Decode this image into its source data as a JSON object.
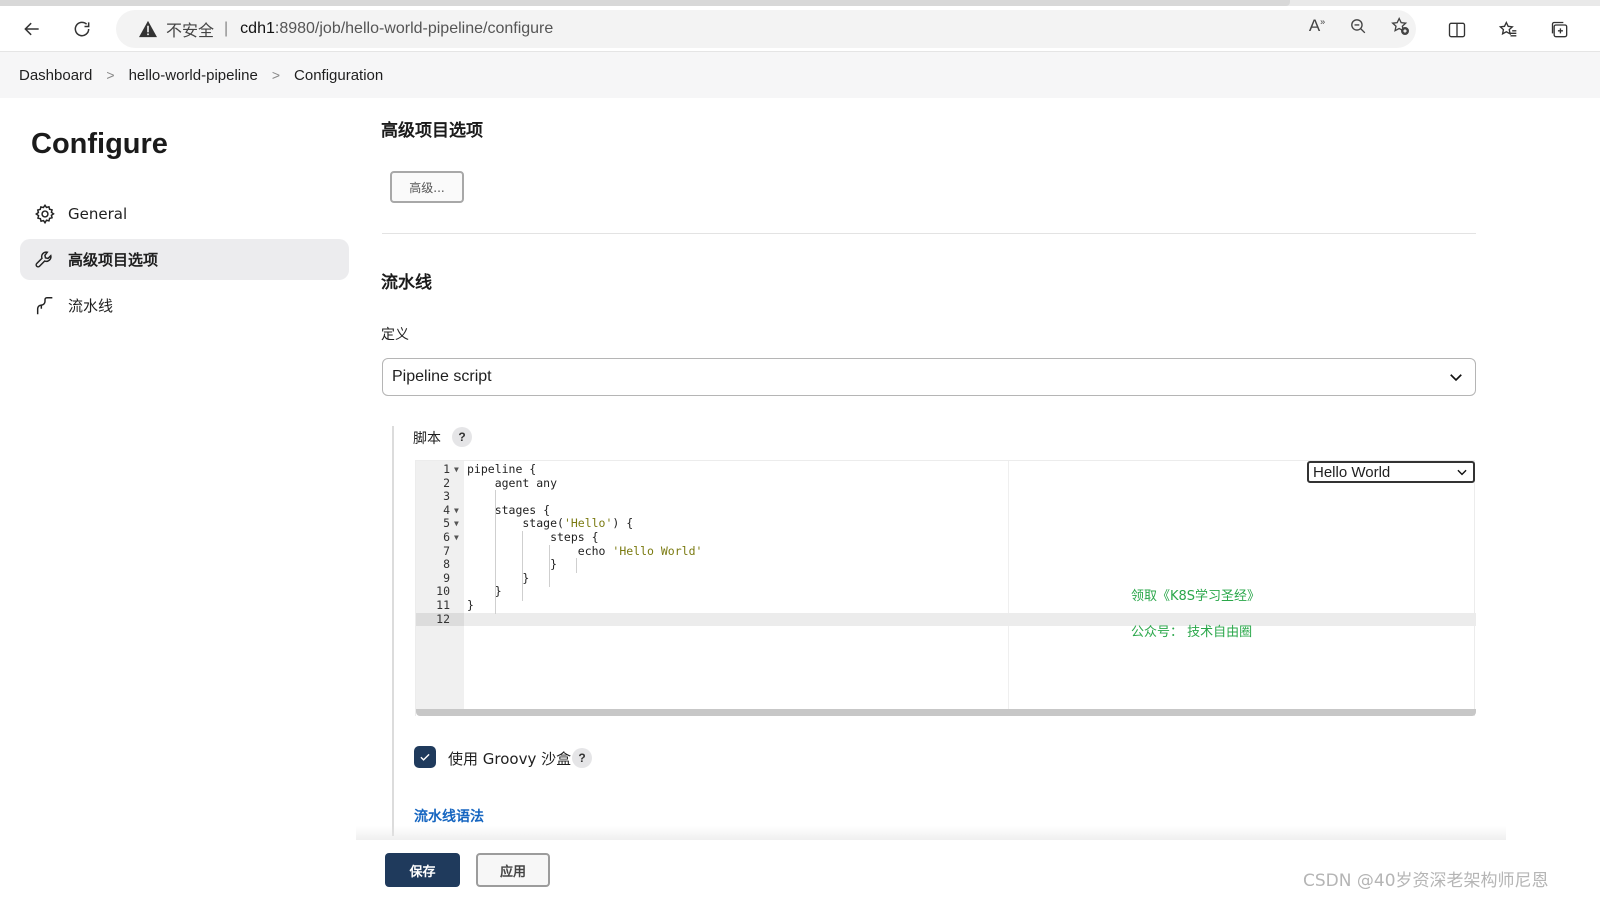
{
  "browser": {
    "security_label": "不安全",
    "separator": "|",
    "url_host": "cdh1",
    "url_path": ":8980/job/hello-world-pipeline/configure"
  },
  "breadcrumb": {
    "items": [
      "Dashboard",
      "hello-world-pipeline",
      "Configuration"
    ],
    "separator": ">"
  },
  "sidebar": {
    "title": "Configure",
    "items": [
      {
        "label": "General",
        "icon": "gear-icon"
      },
      {
        "label": "高级项目选项",
        "icon": "wrench-icon",
        "active": true
      },
      {
        "label": "流水线",
        "icon": "pipeline-icon"
      }
    ]
  },
  "advanced": {
    "title": "高级项目选项",
    "button_label": "高级..."
  },
  "pipeline": {
    "title": "流水线",
    "definition_label": "定义",
    "definition_value": "Pipeline script",
    "script_label": "脚本",
    "help": "?",
    "sample_value": "Hello World",
    "code": [
      {
        "n": "1",
        "text": "pipeline {",
        "fold": true
      },
      {
        "n": "2",
        "text": "    agent any"
      },
      {
        "n": "3",
        "text": ""
      },
      {
        "n": "4",
        "text": "    stages {",
        "fold": true
      },
      {
        "n": "5",
        "pre": "        stage(",
        "str": "'Hello'",
        "post": ") {",
        "fold": true
      },
      {
        "n": "6",
        "text": "            steps {",
        "fold": true
      },
      {
        "n": "7",
        "pre": "                echo ",
        "str": "'Hello World'",
        "post": ""
      },
      {
        "n": "8",
        "text": "            }"
      },
      {
        "n": "9",
        "text": "        }"
      },
      {
        "n": "10",
        "text": "    }"
      },
      {
        "n": "11",
        "text": "}"
      },
      {
        "n": "12",
        "text": "",
        "active": true
      }
    ],
    "promo_line1": "领取《K8S学习圣经》",
    "promo_line2": "公众号： 技术自由圈",
    "sandbox_label": "使用 Groovy 沙盒",
    "syntax_link": "流水线语法"
  },
  "footer": {
    "save_label": "保存",
    "apply_label": "应用"
  },
  "watermark": "CSDN @40岁资深老架构师尼恩",
  "colors": {
    "primary": "#1f3a5c",
    "link": "#1565c0",
    "promo": "#2aa74a"
  }
}
